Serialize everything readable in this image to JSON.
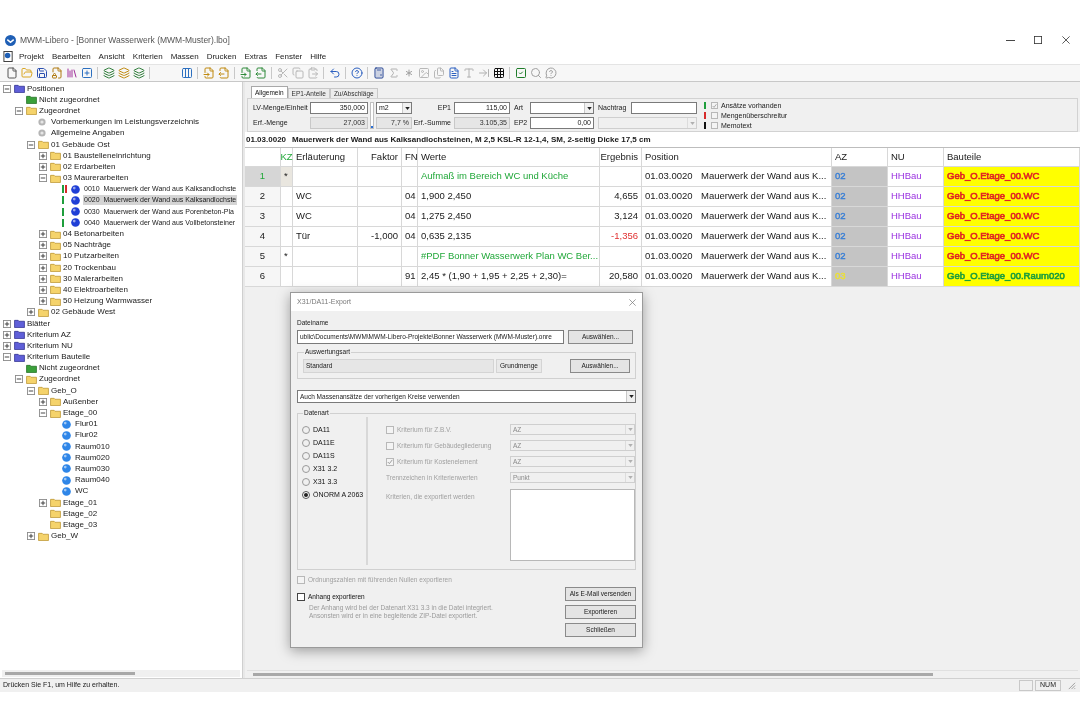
{
  "window": {
    "title": "MWM-Libero - [Bonner Wasserwerk (MWM-Muster).lbo]"
  },
  "menu": [
    "Projekt",
    "Bearbeiten",
    "Ansicht",
    "Kriterien",
    "Massen",
    "Drucken",
    "Extras",
    "Fenster",
    "Hilfe"
  ],
  "tree": [
    {
      "label": "Positionen",
      "kind": "root",
      "expanded": true,
      "selected": false,
      "children": [
        {
          "label": "Nicht zugeordnet",
          "kind": "unassigned",
          "selected": false
        },
        {
          "label": "Zugeordnet",
          "kind": "folder",
          "expanded": true,
          "selected": false,
          "children": [
            {
              "label": "Vorbemerkungen im Leistungsverzeichnis",
              "kind": "note",
              "selected": false
            },
            {
              "label": "Allgemeine Angaben",
              "kind": "note",
              "selected": false
            },
            {
              "label": "01 Gebäude Ost",
              "kind": "folder",
              "expanded": true,
              "selected": false,
              "children": [
                {
                  "label": "01 Baustelleneinrichtung",
                  "kind": "folder",
                  "expanded": false,
                  "selected": false
                },
                {
                  "label": "02 Erdarbeiten",
                  "kind": "folder",
                  "expanded": false,
                  "selected": false
                },
                {
                  "label": "03 Maurerarbeiten",
                  "kind": "folder",
                  "expanded": true,
                  "selected": false,
                  "children": [
                    {
                      "label": "0010  Mauerwerk der Wand aus Kalksandlochste",
                      "kind": "item",
                      "selected": false,
                      "markers": [
                        {
                          "color": "#1f9e3c"
                        },
                        {
                          "color": "#d62b2b"
                        }
                      ]
                    },
                    {
                      "label": "0020  Mauerwerk der Wand aus Kalksandlochste",
                      "kind": "item",
                      "selected": true,
                      "markers": [
                        {
                          "color": "#1f9e3c"
                        }
                      ]
                    },
                    {
                      "label": "0030  Mauerwerk der Wand aus Porenbeton-Pla",
                      "kind": "item",
                      "selected": false,
                      "markers": [
                        {
                          "color": "#1f9e3c"
                        }
                      ]
                    },
                    {
                      "label": "0040  Mauerwerk der Wand aus Vollbetonsteiner",
                      "kind": "item",
                      "selected": false,
                      "markers": [
                        {
                          "color": "#1f9e3c"
                        }
                      ]
                    }
                  ]
                },
                {
                  "label": "04 Betonarbeiten",
                  "kind": "folder",
                  "expanded": false,
                  "selected": false
                },
                {
                  "label": "05 Nachträge",
                  "kind": "folder",
                  "expanded": false,
                  "selected": false
                },
                {
                  "label": "10 Putzarbeiten",
                  "kind": "folder",
                  "expanded": false,
                  "selected": false
                },
                {
                  "label": "20 Trockenbau",
                  "kind": "folder",
                  "expanded": false,
                  "selected": false
                },
                {
                  "label": "30 Malerarbeiten",
                  "kind": "folder",
                  "expanded": false,
                  "selected": false
                },
                {
                  "label": "40 Elektroarbeiten",
                  "kind": "folder",
                  "expanded": false,
                  "selected": false
                },
                {
                  "label": "50 Heizung Warmwasser",
                  "kind": "folder",
                  "expanded": false,
                  "selected": false
                }
              ]
            },
            {
              "label": "02 Gebäude West",
              "kind": "folder",
              "expanded": false,
              "selected": false
            }
          ]
        }
      ]
    },
    {
      "label": "Blätter",
      "kind": "root",
      "expanded": false,
      "selected": false
    },
    {
      "label": "Kriterium AZ",
      "kind": "root",
      "expanded": false,
      "selected": false
    },
    {
      "label": "Kriterium NU",
      "kind": "root",
      "expanded": false,
      "selected": false
    },
    {
      "label": "Kriterium Bauteile",
      "kind": "root",
      "expanded": true,
      "selected": false,
      "children": [
        {
          "label": "Nicht zugeordnet",
          "kind": "unassigned",
          "selected": false
        },
        {
          "label": "Zugeordnet",
          "kind": "folder",
          "expanded": true,
          "selected": false,
          "children": [
            {
              "label": "Geb_O",
              "kind": "folder",
              "expanded": true,
              "selected": false,
              "children": [
                {
                  "label": "Außenber",
                  "kind": "folder",
                  "expanded": false,
                  "selected": false
                },
                {
                  "label": "Etage_00",
                  "kind": "folder",
                  "expanded": true,
                  "selected": false,
                  "children": [
                    {
                      "label": "Flur01",
                      "kind": "criterion",
                      "selected": false
                    },
                    {
                      "label": "Flur02",
                      "kind": "criterion",
                      "selected": false
                    },
                    {
                      "label": "Raum010",
                      "kind": "criterion",
                      "selected": false
                    },
                    {
                      "label": "Raum020",
                      "kind": "criterion",
                      "selected": false
                    },
                    {
                      "label": "Raum030",
                      "kind": "criterion",
                      "selected": false
                    },
                    {
                      "label": "Raum040",
                      "kind": "criterion",
                      "selected": false
                    },
                    {
                      "label": "WC",
                      "kind": "criterion",
                      "selected": false
                    }
                  ]
                },
                {
                  "label": "Etage_01",
                  "kind": "folder",
                  "expanded": false,
                  "selected": false
                },
                {
                  "label": "Etage_02",
                  "kind": "folder",
                  "selected": false
                },
                {
                  "label": "Etage_03",
                  "kind": "folder",
                  "selected": false
                }
              ]
            },
            {
              "label": "Geb_W",
              "kind": "folder",
              "expanded": false,
              "selected": false
            }
          ]
        }
      ]
    }
  ],
  "tabs": [
    {
      "label": "Allgemein",
      "selected": true
    },
    {
      "label": "EP1-Anteile",
      "selected": false
    },
    {
      "label": "Zu/Abschläge",
      "selected": false
    }
  ],
  "form": {
    "lv_menge": {
      "label": "LV-Menge/Einheit",
      "value": "350,000"
    },
    "einheit": {
      "value": "m2"
    },
    "erf_menge": {
      "label": "Erf.-Menge",
      "value": "27,003",
      "readonly": true
    },
    "erf_progress": {
      "level": 0.077
    },
    "erf_percent": {
      "value": "7,7 %",
      "readonly": true
    },
    "ep1": {
      "label": "EP1",
      "value": "115,00"
    },
    "erf_summe": {
      "label": "Erf.-Summe",
      "value": "3.105,35",
      "readonly": true
    },
    "art": {
      "label": "Art"
    },
    "ep2": {
      "label": "EP2",
      "value": "0,00"
    },
    "nachtrag": {
      "label": "Nachtrag"
    },
    "row2_dropdown": {
      "disabled": true
    },
    "flags": [
      {
        "label": "Ansätze vorhanden",
        "checked": true,
        "color": "#1f9e3c"
      },
      {
        "label": "Mengenüberschreitur",
        "checked": false,
        "color": "#d62b2b"
      },
      {
        "label": "Memotext",
        "checked": false,
        "color": "#111111"
      }
    ]
  },
  "position_header": {
    "number": "01.03.0020",
    "text": "Mauerwerk der Wand aus Kalksandlochsteinen, M 2,5 KSL-R 12-1,4, SM, 2-seitig Dicke 17,5 cm"
  },
  "table": {
    "columns": [
      "KZ",
      "Erläuterung",
      "Faktor",
      "FN",
      "Werte",
      "Ergebnis",
      "Position",
      "AZ",
      "NU",
      "Bauteile"
    ],
    "rows": [
      {
        "number": "1",
        "selected": true,
        "kind": "comment",
        "kz": "*",
        "werte": "Aufmaß im Bereich WC und Küche",
        "position": {
          "number": "01.03.0020",
          "text": "Mauerwerk der Wand aus K..."
        },
        "az": {
          "value": "02",
          "color": "#3a7fd5"
        },
        "nu": "HHBau",
        "bauteile": {
          "value": "Geb_O.Etage_00.WC",
          "color": "#e02424"
        }
      },
      {
        "number": "2",
        "selected": false,
        "kind": "measure",
        "erlaeuterung": "WC",
        "fn": "04",
        "werte": "1,900 2,450",
        "ergebnis": "4,655",
        "negative": false,
        "position": {
          "number": "01.03.0020",
          "text": "Mauerwerk der Wand aus K..."
        },
        "az": {
          "value": "02",
          "color": "#3a7fd5"
        },
        "nu": "HHBau",
        "bauteile": {
          "value": "Geb_O.Etage_00.WC",
          "color": "#e02424"
        }
      },
      {
        "number": "3",
        "selected": false,
        "kind": "measure",
        "erlaeuterung": "WC",
        "fn": "04",
        "werte": "1,275 2,450",
        "ergebnis": "3,124",
        "negative": false,
        "position": {
          "number": "01.03.0020",
          "text": "Mauerwerk der Wand aus K..."
        },
        "az": {
          "value": "02",
          "color": "#3a7fd5"
        },
        "nu": "HHBau",
        "bauteile": {
          "value": "Geb_O.Etage_00.WC",
          "color": "#e02424"
        }
      },
      {
        "number": "4",
        "selected": false,
        "kind": "measure",
        "erlaeuterung": "Tür",
        "faktor": "-1,000",
        "fn": "04",
        "werte": "0,635 2,135",
        "ergebnis": "-1,356",
        "negative": true,
        "position": {
          "number": "01.03.0020",
          "text": "Mauerwerk der Wand aus K..."
        },
        "az": {
          "value": "02",
          "color": "#3a7fd5"
        },
        "nu": "HHBau",
        "bauteile": {
          "value": "Geb_O.Etage_00.WC",
          "color": "#e02424"
        }
      },
      {
        "number": "5",
        "selected": false,
        "kind": "comment",
        "kz": "*",
        "werte": "#PDF Bonner Wasserwerk Plan WC Ber...",
        "position": {
          "number": "01.03.0020",
          "text": "Mauerwerk der Wand aus K..."
        },
        "az": {
          "value": "02",
          "color": "#3a7fd5"
        },
        "nu": "HHBau",
        "bauteile": {
          "value": "Geb_O.Etage_00.WC",
          "color": "#e02424"
        }
      },
      {
        "number": "6",
        "selected": false,
        "kind": "measure",
        "fn": "91",
        "werte": "2,45 * (1,90 + 1,95 + 2,25 + 2,30)=",
        "ergebnis": "20,580",
        "negative": false,
        "position": {
          "number": "01.03.0020",
          "text": "Mauerwerk der Wand aus K..."
        },
        "az": {
          "value": "03",
          "color": "#ece034"
        },
        "nu": "HHBau",
        "bauteile": {
          "value": "Geb_O.Etage_00.Raum020",
          "color": "#1e9e3c"
        }
      }
    ]
  },
  "dialog": {
    "title": "X31/DA11-Export",
    "file": {
      "label": "Dateiname",
      "value": "ublic\\Documents\\MWM\\MWM-Libero-Projekte\\Bonner Wasserwerk (MWM-Muster).onre",
      "button": "Auswählen..."
    },
    "evaluation": {
      "legend": "Auswertungsart",
      "value": "Standard",
      "quantity": "Grundmenge",
      "button": "Auswählen..."
    },
    "mode_select": {
      "value": "Auch Massenansätze der vorherigen Kreise verwenden"
    },
    "data_type": {
      "legend": "Datenart",
      "options": [
        {
          "label": "DA11",
          "selected": false
        },
        {
          "label": "DA11E",
          "selected": false
        },
        {
          "label": "DA11S",
          "selected": false
        },
        {
          "label": "X31 3.2",
          "selected": false
        },
        {
          "label": "X31 3.3",
          "selected": false
        },
        {
          "label": "ÖNORM A 2063",
          "selected": true
        }
      ],
      "criteria": [
        {
          "label": "Kriterium für Z.B.V.",
          "checked": false,
          "disabled": true,
          "value": "AZ"
        },
        {
          "label": "Kriterium für Gebäudegliederung",
          "checked": false,
          "disabled": true,
          "value": "AZ"
        },
        {
          "label": "Kriterium für Kostenelement",
          "checked": true,
          "disabled": true,
          "value": "AZ"
        }
      ],
      "separator": {
        "label": "Trennzeichen in Kriterienwerten",
        "value": "Punkt",
        "disabled": true
      },
      "export_list": {
        "label": "Kriterien, die exportiert werden",
        "disabled": true
      }
    },
    "options": [
      {
        "label": "Ordnungszahlen mit führenden Nullen exportieren",
        "checked": false,
        "disabled": true
      },
      {
        "label": "Anhang exportieren",
        "checked": false,
        "disabled": false
      }
    ],
    "note": [
      "Der Anhang wird bei der Datenart X31 3.3 in die Datei integriert.",
      "Ansonsten wird er in eine begleitende ZIP-Datei exportiert."
    ],
    "buttons": [
      "Als E-Mail versenden",
      "Exportieren",
      "Schließen"
    ]
  },
  "status_bar": {
    "text": "Drücken Sie F1, um Hilfe zu erhalten.",
    "indicator": "NUM"
  }
}
